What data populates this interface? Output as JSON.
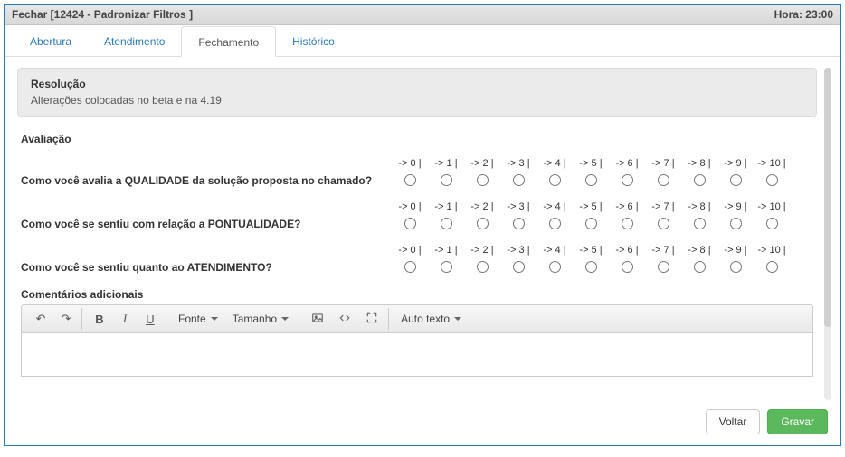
{
  "titlebar": {
    "left": "Fechar [12424 - Padronizar Filtros ]",
    "right": "Hora: 23:00"
  },
  "tabs": [
    {
      "id": "abertura",
      "label": "Abertura",
      "active": false
    },
    {
      "id": "atendimento",
      "label": "Atendimento",
      "active": false
    },
    {
      "id": "fechamento",
      "label": "Fechamento",
      "active": true
    },
    {
      "id": "historico",
      "label": "Histórico",
      "active": false
    }
  ],
  "resolution": {
    "title": "Resolução",
    "text": "Alterações colocadas no beta e na 4.19"
  },
  "evaluation": {
    "title": "Avaliação",
    "scale_labels": [
      "-> 0 |",
      "-> 1 |",
      "-> 2 |",
      "-> 3 |",
      "-> 4 |",
      "-> 5 |",
      "-> 6 |",
      "-> 7 |",
      "-> 8 |",
      "-> 9 |",
      "-> 10 |"
    ],
    "questions": [
      "Como você avalia a QUALIDADE da solução proposta no chamado?",
      "Como você se sentiu com relação a PONTUALIDADE?",
      "Como você se sentiu quanto ao ATENDIMENTO?"
    ],
    "comments_label": "Comentários adicionais"
  },
  "toolbar": {
    "font_label": "Fonte",
    "size_label": "Tamanho",
    "autotext_label": "Auto texto"
  },
  "footer": {
    "back_label": "Voltar",
    "save_label": "Gravar"
  }
}
